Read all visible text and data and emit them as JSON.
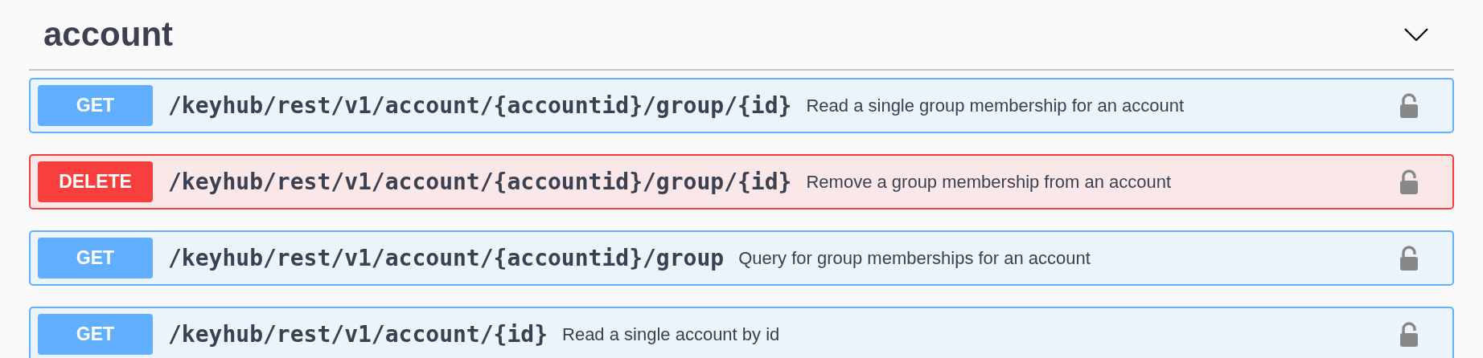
{
  "section": {
    "title": "account",
    "expanded": true
  },
  "operations": [
    {
      "method": "GET",
      "path": "/keyhub/rest/v1/account/{accountid}/group/{id}",
      "summary": "Read a single group membership for an account",
      "locked": false
    },
    {
      "method": "DELETE",
      "path": "/keyhub/rest/v1/account/{accountid}/group/{id}",
      "summary": "Remove a group membership from an account",
      "locked": false
    },
    {
      "method": "GET",
      "path": "/keyhub/rest/v1/account/{accountid}/group",
      "summary": "Query for group memberships for an account",
      "locked": false
    },
    {
      "method": "GET",
      "path": "/keyhub/rest/v1/account/{id}",
      "summary": "Read a single account by id",
      "locked": false
    }
  ]
}
